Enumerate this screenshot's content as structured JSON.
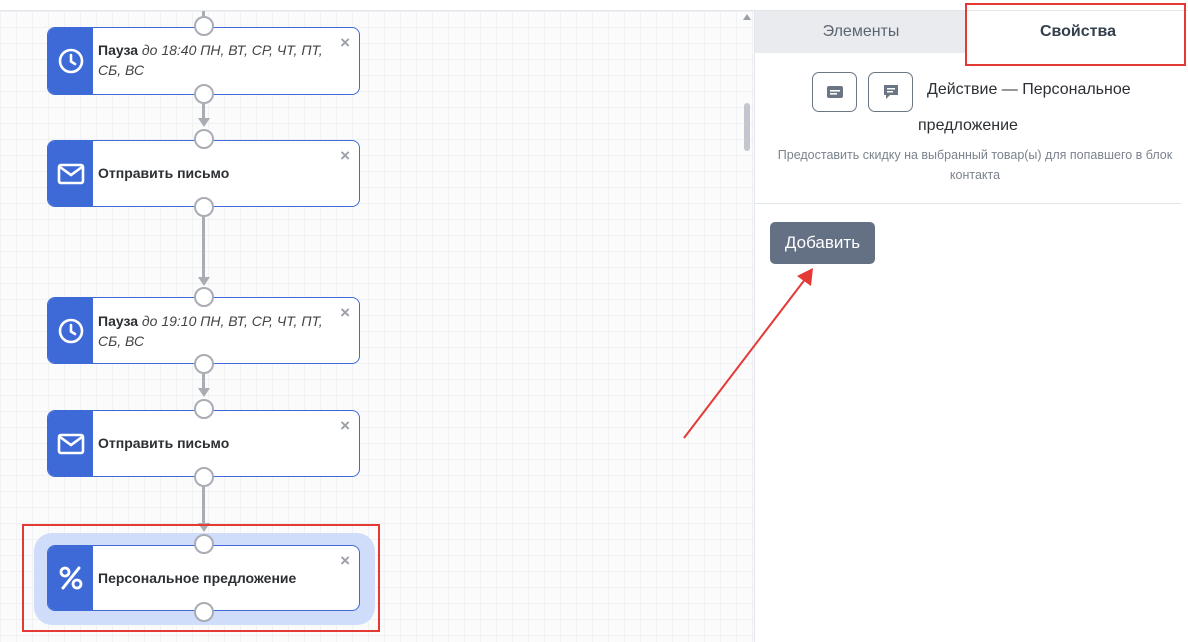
{
  "nodes": [
    {
      "title": "Пауза",
      "detail": "до 18:40 ПН, ВТ, СР, ЧТ, ПТ, СБ, ВС",
      "icon": "clock-icon"
    },
    {
      "title": "Отправить письмо",
      "icon": "envelope-icon"
    },
    {
      "title": "Пауза",
      "detail": "до 19:10 ПН, ВТ, СР, ЧТ, ПТ, СБ, ВС",
      "icon": "clock-icon"
    },
    {
      "title": "Отправить письмо",
      "icon": "envelope-icon"
    },
    {
      "title": "Персональное предложение",
      "icon": "percent-icon"
    }
  ],
  "close_glyph": "×",
  "panel": {
    "tabs": [
      "Элементы",
      "Свойства"
    ],
    "active_tab": "Свойства",
    "title_line1": "Действие — Персональное",
    "title_line2": "предложение",
    "description": "Предоставить скидку на выбранный товар(ы) для попавшего в блок контакта",
    "add_button": "Добавить"
  },
  "colors": {
    "node_accent": "#3d6ad6",
    "selected_bg": "#cfdcfa",
    "annotation": "#e53935",
    "add_button": "#647184"
  }
}
